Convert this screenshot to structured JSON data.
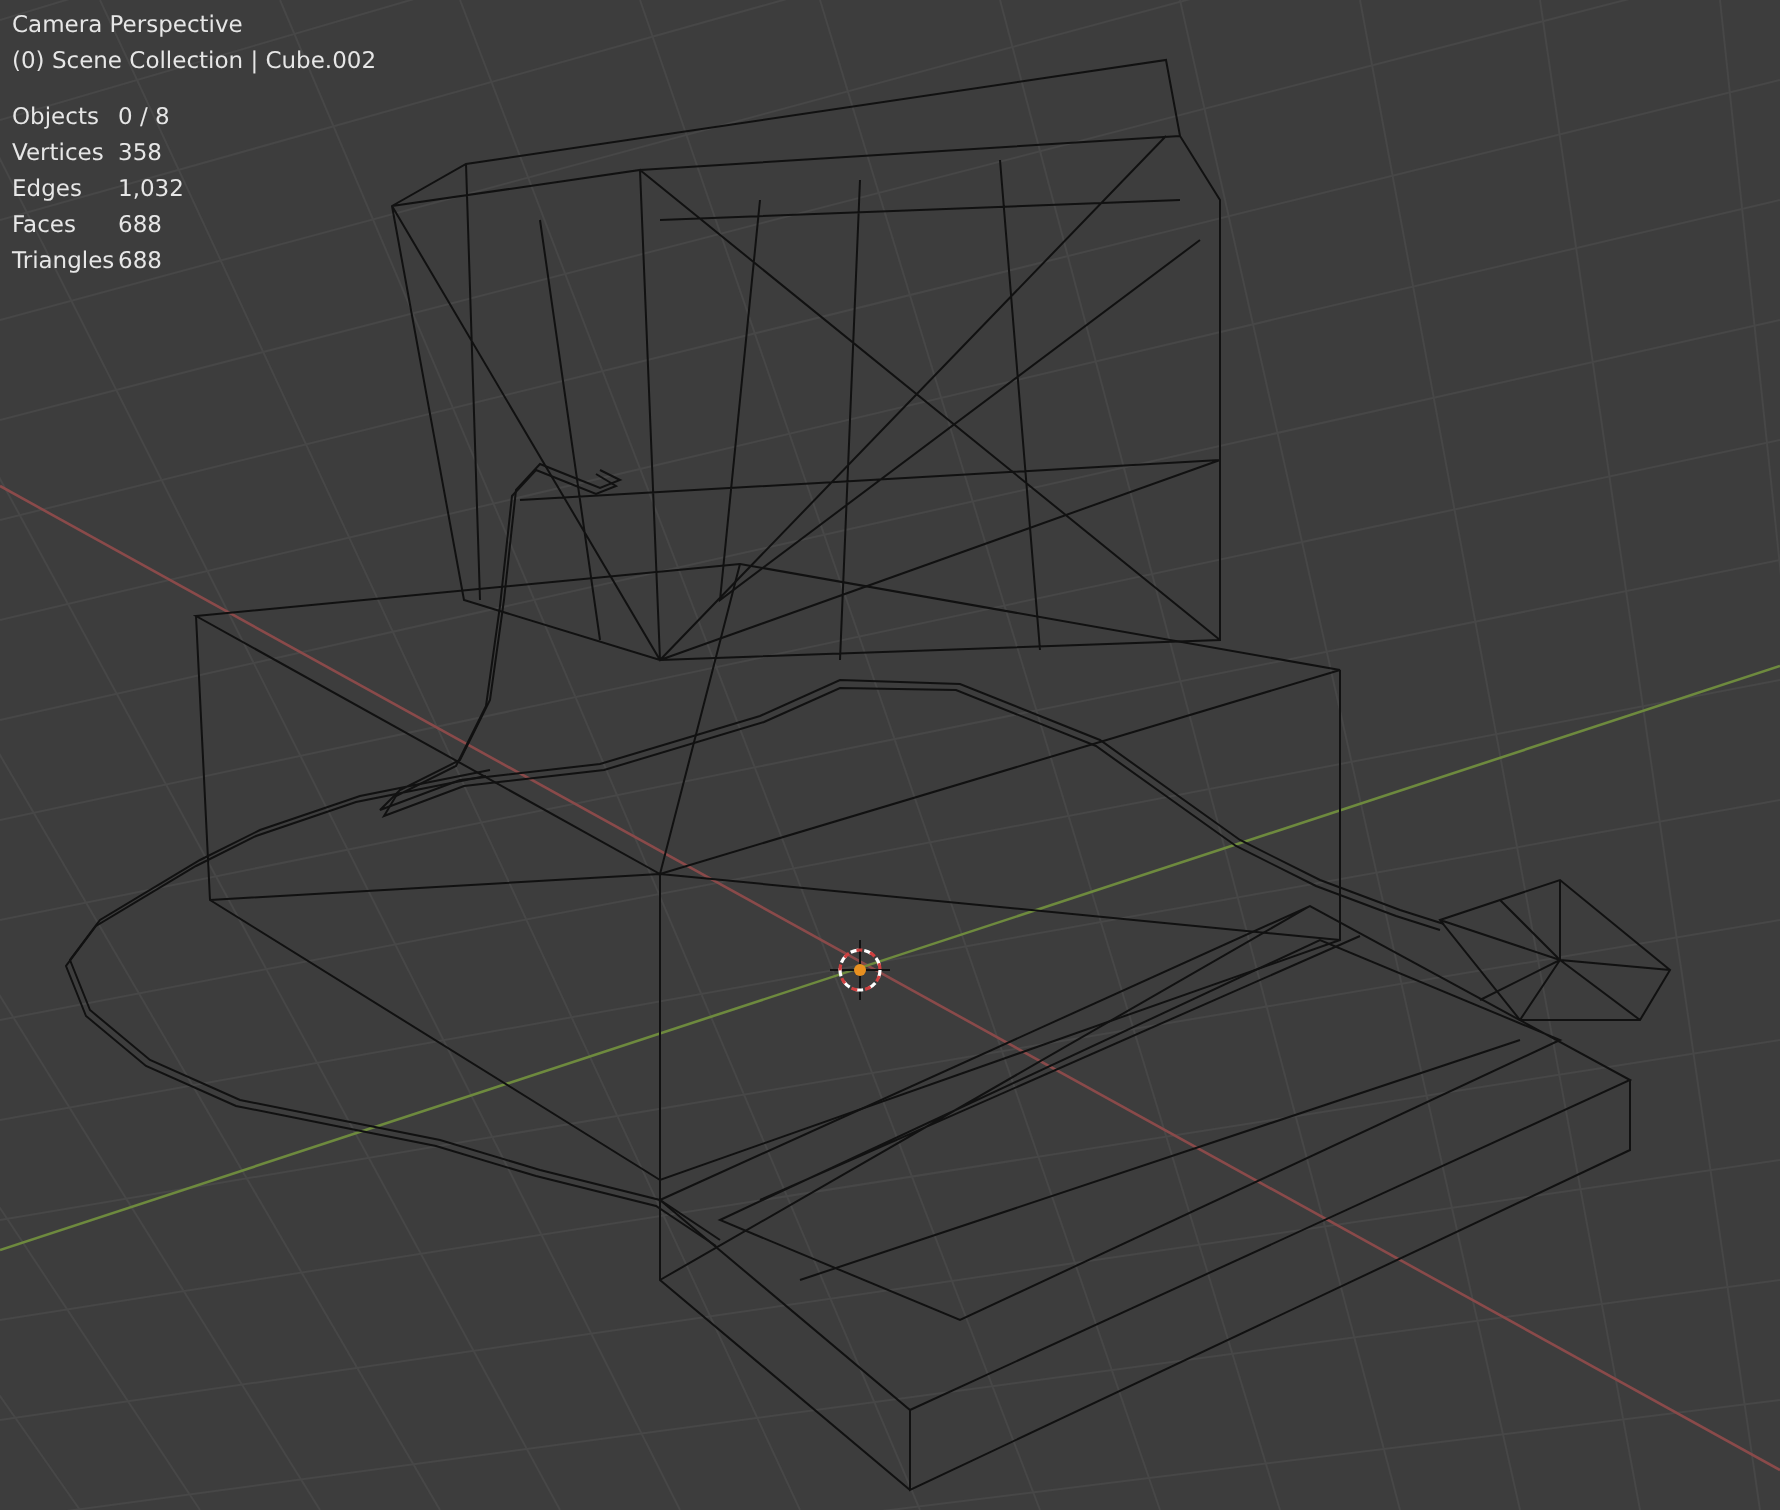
{
  "viewport": {
    "view_name": "Camera Perspective",
    "collection_label": "(0) Scene Collection | Cube.002"
  },
  "stats": [
    {
      "label": "Objects",
      "value": "0 / 8"
    },
    {
      "label": "Vertices",
      "value": "358"
    },
    {
      "label": "Edges",
      "value": "1,032"
    },
    {
      "label": "Faces",
      "value": "688"
    },
    {
      "label": "Triangles",
      "value": "688"
    }
  ]
}
